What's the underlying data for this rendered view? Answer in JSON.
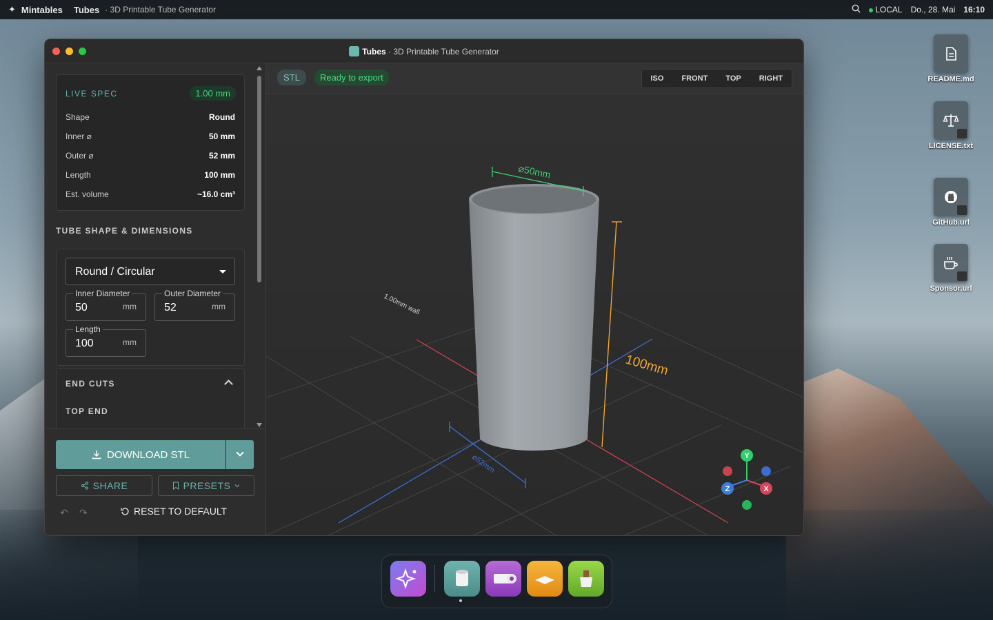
{
  "menubar": {
    "app": "Mintables",
    "menu_title": "Tubes",
    "menu_sub": "· 3D Printable Tube Generator",
    "status": "LOCAL",
    "date": "Do., 28. Mai",
    "time": "16:10"
  },
  "window": {
    "title": "Tubes",
    "subtitle": "· 3D Printable Tube Generator"
  },
  "spec": {
    "heading": "LIVE SPEC",
    "badge": "1.00 mm",
    "rows": [
      {
        "label": "Shape",
        "value": "Round"
      },
      {
        "label": "Inner ⌀",
        "value": "50 mm"
      },
      {
        "label": "Outer ⌀",
        "value": "52 mm"
      },
      {
        "label": "Length",
        "value": "100 mm"
      },
      {
        "label": "Est. volume",
        "value": "~16.0 cm³"
      }
    ]
  },
  "dims": {
    "heading": "TUBE SHAPE & DIMENSIONS",
    "shape_select": "Round / Circular",
    "inner": {
      "label": "Inner Diameter",
      "value": "50",
      "unit": "mm"
    },
    "outer": {
      "label": "Outer Diameter",
      "value": "52",
      "unit": "mm"
    },
    "length": {
      "label": "Length",
      "value": "100",
      "unit": "mm"
    }
  },
  "cuts": {
    "heading": "END CUTS",
    "sub": "TOP END"
  },
  "footer": {
    "download": "DOWNLOAD STL",
    "share": "SHARE",
    "presets": "PRESETS",
    "reset": "RESET TO DEFAULT"
  },
  "viewport": {
    "format": "STL",
    "status": "Ready to export",
    "views": [
      "ISO",
      "FRONT",
      "TOP",
      "RIGHT"
    ],
    "label_top": "⌀50mm",
    "label_height": "100mm",
    "label_wall": "1.00mm wall",
    "label_bottom": "⌀52mm",
    "axis_y": "Y",
    "axis_z": "Z",
    "axis_x": "X"
  },
  "desktop": [
    {
      "name": "README.md"
    },
    {
      "name": "LICENSE.txt"
    },
    {
      "name": "GitHub.url"
    },
    {
      "name": "Sponsor.url"
    }
  ],
  "colors": {
    "accent": "#5f9c9a",
    "ready": "#4ada7f",
    "axis_x": "#d9455a",
    "axis_y": "#2fd06a",
    "axis_z": "#3a7ed8"
  }
}
